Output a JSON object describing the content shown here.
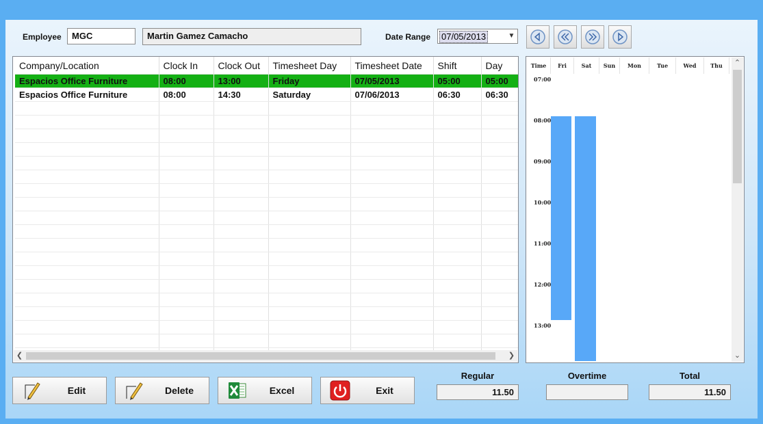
{
  "header": {
    "employee_label": "Employee",
    "employee_code": "MGC",
    "employee_name": "Martin Gamez Camacho",
    "date_range_label": "Date Range",
    "date_range_value": "07/05/2013"
  },
  "nav_icons": [
    "first-icon",
    "previous-icon",
    "next-icon",
    "last-icon"
  ],
  "grid": {
    "columns": [
      "Company/Location",
      "Clock In",
      "Clock Out",
      "Timesheet Day",
      "Timesheet Date",
      "Shift",
      "Day"
    ],
    "rows": [
      [
        "Espacios Office Furniture",
        "08:00",
        "13:00",
        "Friday",
        "07/05/2013",
        "05:00",
        "05:00"
      ],
      [
        "Espacios Office Furniture",
        "08:00",
        "14:30",
        "Saturday",
        "07/06/2013",
        "06:30",
        "06:30"
      ]
    ],
    "selected_row": 0,
    "selected_color": "#14b014"
  },
  "calendar": {
    "headers": [
      "Time",
      "Fri",
      "Sat",
      "Sun",
      "Mon",
      "Tue",
      "Wed",
      "Thu"
    ],
    "times": [
      "07:00",
      "08:00",
      "09:00",
      "10:00",
      "11:00",
      "12:00",
      "13:00"
    ],
    "blocks": [
      {
        "day": "Fri",
        "start": "08:00",
        "end": "13:00"
      },
      {
        "day": "Sat",
        "start": "08:00",
        "end": "14:30"
      }
    ],
    "block_color": "#58a8f8"
  },
  "buttons": {
    "edit": "Edit",
    "delete": "Delete",
    "excel": "Excel",
    "exit": "Exit"
  },
  "summary": {
    "regular_label": "Regular",
    "regular_value": "11.50",
    "overtime_label": "Overtime",
    "overtime_value": "",
    "total_label": "Total",
    "total_value": "11.50"
  }
}
